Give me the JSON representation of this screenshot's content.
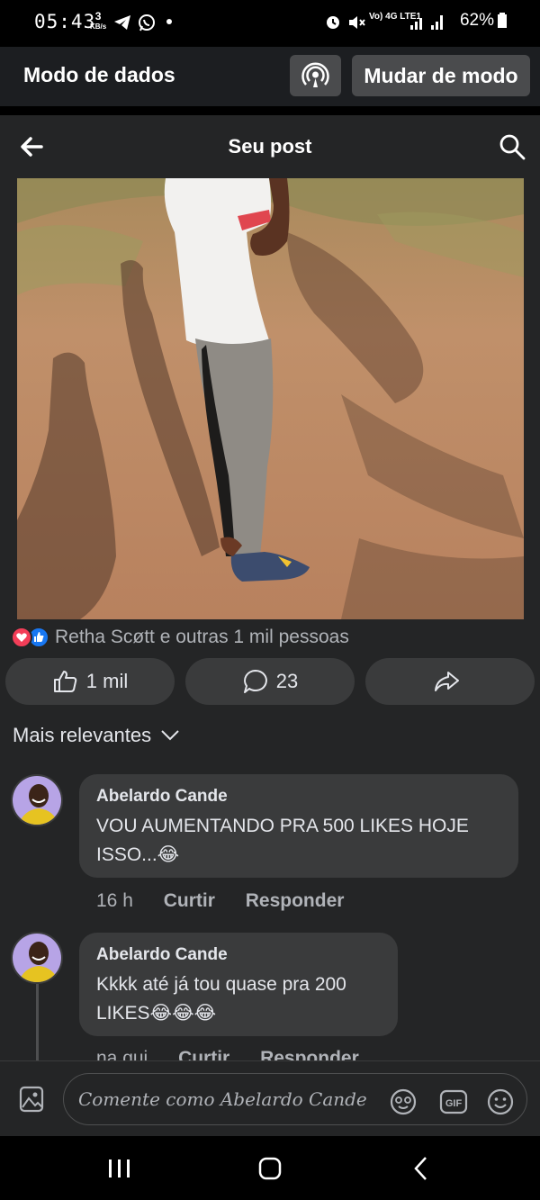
{
  "status_bar": {
    "time": "05:43",
    "speed_value": "3",
    "speed_unit": "KB/s",
    "network": "Vo) 4G LTE1",
    "battery": "62%"
  },
  "data_mode": {
    "title": "Modo de dados",
    "switch_label": "Mudar de modo"
  },
  "header": {
    "title": "Seu post"
  },
  "reactions": {
    "text": "Retha Scøtt e outras 1 mil pessoas"
  },
  "actions": {
    "like_count": "1 mil",
    "comment_count": "23"
  },
  "sort": {
    "label": "Mais relevantes"
  },
  "comments": [
    {
      "author": "Abelardo Cande",
      "text": "VOU AUMENTANDO PRA 500 LIKES HOJE ISSO...😂",
      "time": "16 h",
      "like_label": "Curtir",
      "reply_label": "Responder"
    },
    {
      "author": "Abelardo Cande",
      "text": "Kkkk até já tou quase pra 200 LIKES😂😂😂",
      "time": "na qui",
      "like_label": "Curtir",
      "reply_label": "Responder"
    }
  ],
  "compose": {
    "placeholder": "Comente como Abelardo Cande"
  },
  "colors": {
    "background": "#242526",
    "bubble": "#3a3b3c",
    "like_blue": "#1877f2",
    "love_red": "#f33e58"
  }
}
